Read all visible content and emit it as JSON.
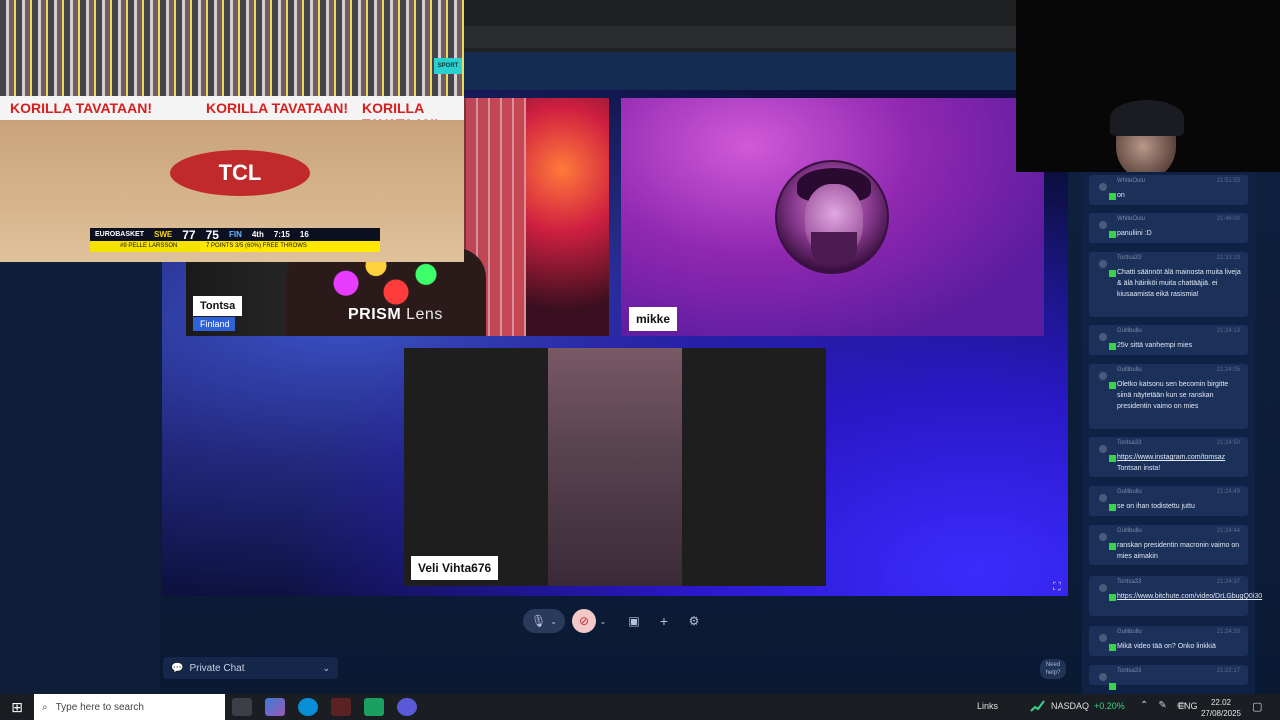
{
  "stage": {
    "participants": [
      {
        "name": "Tontsa",
        "location": "Finland",
        "overlay_brand": "PRISM",
        "overlay_brand_suffix": "Lens"
      },
      {
        "name": "mikke"
      },
      {
        "name": "Veli Vihta676"
      }
    ]
  },
  "controls": {
    "private_chat_label": "Private Chat",
    "need_help_label": "Need help?"
  },
  "chat": {
    "messages": [
      {
        "user": "WhiteOulu",
        "time": "21:51:53",
        "text": "on"
      },
      {
        "user": "WhiteOulu",
        "time": "21:46:00",
        "text": "panuliini :D"
      },
      {
        "user": "Tontsa33",
        "time": "21:33:19",
        "text": "Chatti säännöt älä mainosta muita liveja & älä häiriköi muita chattääjiä. ei kiusaamista eikä rasismia!"
      },
      {
        "user": "Gullibullu",
        "time": "21:24:13",
        "text": "25v sittä vanhempi mies"
      },
      {
        "user": "Gullibullu",
        "time": "21:24:05",
        "text": "Oletko katsonu sen becomin birgitte siinä näytetään kun se ranskan presidentin vaimo on mies"
      },
      {
        "user": "Tontsa33",
        "time": "21:24:50",
        "text_link": "https://www.instagram.com/tomsaz",
        "text_after": " Tontsan insta!"
      },
      {
        "user": "Gullibullu",
        "time": "21:24:49",
        "text": "se on ihan todistettu juttu"
      },
      {
        "user": "Gullibullu",
        "time": "21:24:44",
        "text": "ranskan presidentin macronin vaimo on mies aimakin"
      },
      {
        "user": "Tontsa33",
        "time": "21:24:37",
        "text_link": "https://www.bitchute.com/video/DrLGbugQ0i30",
        "text_after": ""
      },
      {
        "user": "Gullibullu",
        "time": "21:24:20",
        "text": "Mikä video tää on? Onko linkkiä"
      },
      {
        "user": "Tontsa33",
        "time": "21:22:17",
        "text": ""
      }
    ]
  },
  "broadcast": {
    "ads": [
      "KORILLA TAVATAAN!",
      "KORILLA TAVATAAN!",
      "KORILLA TAVATAAN!"
    ],
    "court_logo": "TCL",
    "corner_logo": "SPORT",
    "scoreboard": {
      "league": "EUROBASKET",
      "home": "SWE",
      "home_score": "77",
      "away_score": "75",
      "away": "FIN",
      "period": "4th",
      "clock": "7:15",
      "shot_clock": "16",
      "player": "#9 PELLE LARSSON",
      "stat": "7 POINTS  3/5 (60%) FREE THROWS"
    }
  },
  "taskbar": {
    "search_placeholder": "Type here to search",
    "links_label": "Links",
    "stock_name": "NASDAQ",
    "stock_change": "+0.20%",
    "lang": "ENG",
    "time": "22.02",
    "date": "27/08/2025"
  },
  "colors": {
    "accent": "#2f62d8",
    "stage_blue": "#2a18c8",
    "stock_up": "#3ad28a"
  }
}
